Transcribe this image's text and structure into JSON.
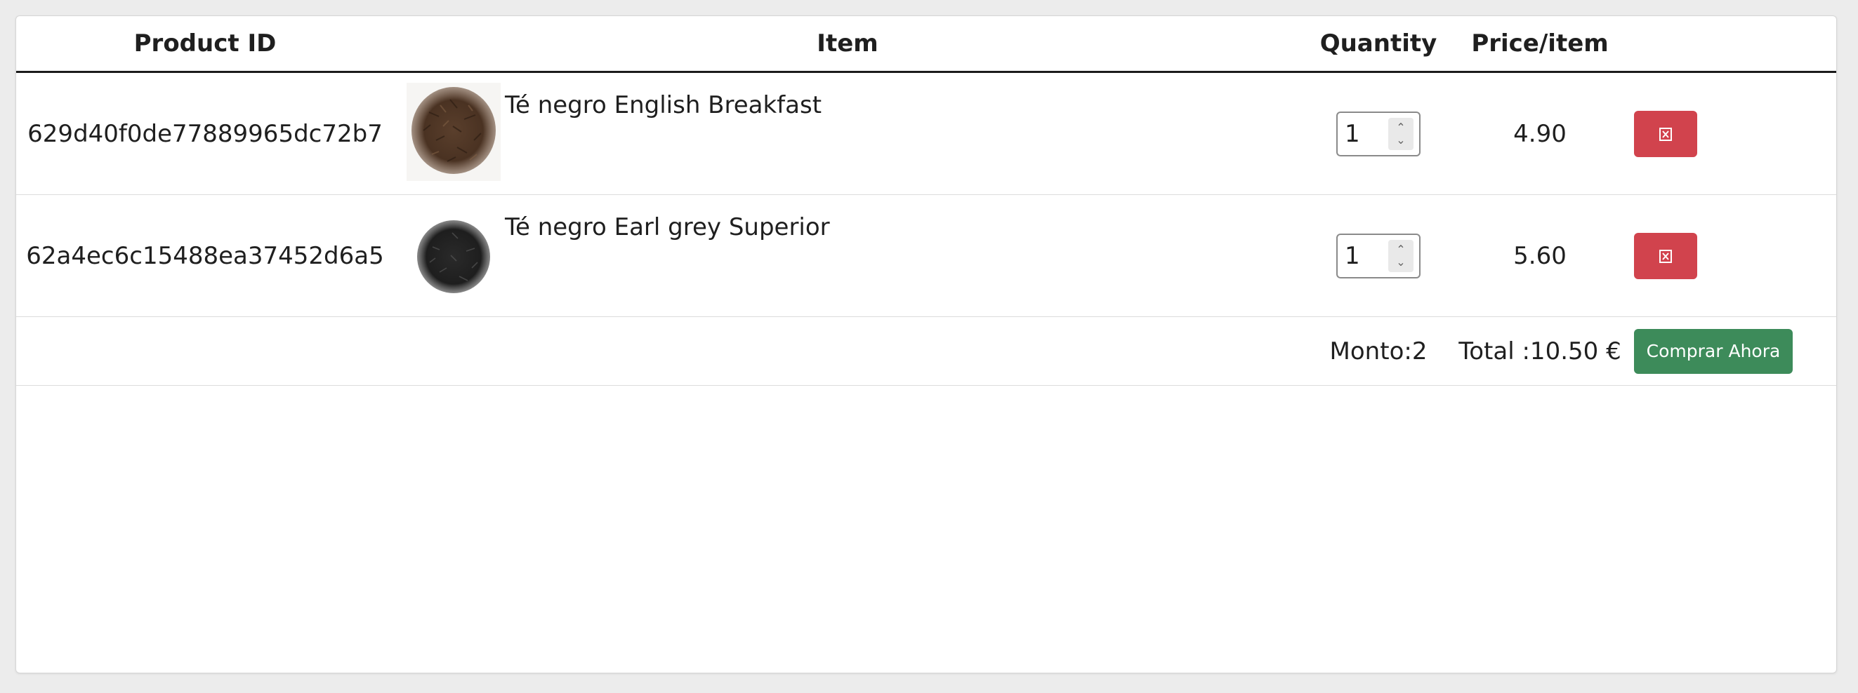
{
  "table": {
    "headers": {
      "product_id": "Product ID",
      "item": "Item",
      "quantity": "Quantity",
      "price": "Price/item",
      "actions": ""
    },
    "rows": [
      {
        "product_id": "629d40f0de77889965dc72b7",
        "item_name": "Té negro English Breakfast",
        "image": "tea-leaves-brown",
        "quantity": "1",
        "price": "4.90",
        "delete_icon": "delete-icon"
      },
      {
        "product_id": "62a4ec6c15488ea37452d6a5",
        "item_name": "Té negro Earl grey Superior",
        "image": "tea-leaves-black",
        "quantity": "1",
        "price": "5.60",
        "delete_icon": "delete-icon"
      }
    ],
    "footer": {
      "amount_label": "Monto:2",
      "total_label": "Total :10.50 €",
      "buy_button": "Comprar Ahora"
    }
  },
  "colors": {
    "delete": "#d1434d",
    "buy": "#3d8b5a",
    "header_rule": "#1b1b1b",
    "background": "#ececec"
  }
}
